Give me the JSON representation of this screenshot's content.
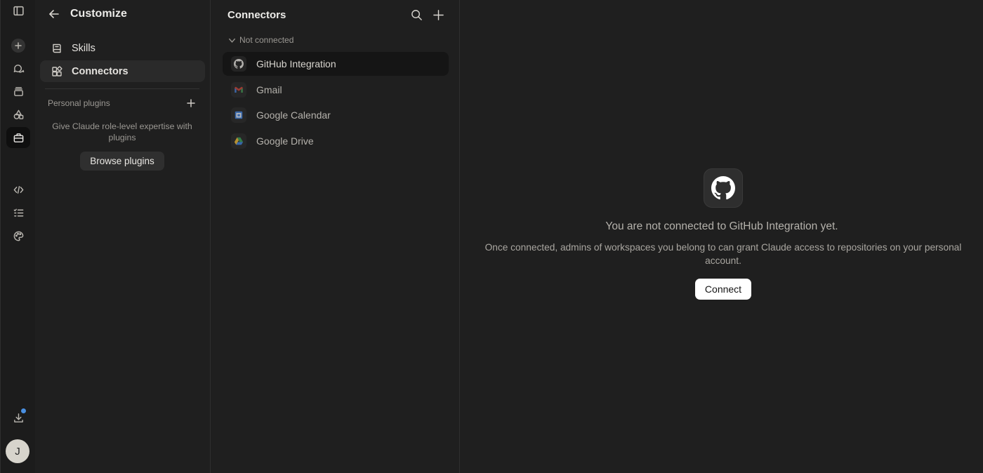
{
  "rail": {
    "items": [
      {
        "icon": "sidebar-toggle-icon"
      },
      {
        "icon": "plus-icon"
      },
      {
        "icon": "chats-icon"
      },
      {
        "icon": "projects-icon"
      },
      {
        "icon": "artifacts-icon"
      },
      {
        "icon": "briefcase-icon"
      },
      {
        "icon": "code-icon"
      },
      {
        "icon": "tasks-icon"
      },
      {
        "icon": "palette-icon"
      },
      {
        "icon": "download-icon"
      }
    ],
    "avatar_initial": "J",
    "notification_color": "#4a90e2"
  },
  "customize": {
    "title": "Customize",
    "nav": [
      {
        "label": "Skills",
        "icon": "skills-icon"
      },
      {
        "label": "Connectors",
        "icon": "connectors-icon",
        "active": true
      }
    ],
    "plugins_header": "Personal plugins",
    "plugins_text": "Give Claude role-level expertise with plugins",
    "browse_label": "Browse plugins"
  },
  "connectors": {
    "title": "Connectors",
    "section_label": "Not connected",
    "items": [
      {
        "label": "GitHub Integration",
        "icon": "github-icon",
        "active": true
      },
      {
        "label": "Gmail",
        "icon": "gmail-icon"
      },
      {
        "label": "Google Calendar",
        "icon": "google-calendar-icon"
      },
      {
        "label": "Google Drive",
        "icon": "google-drive-icon"
      }
    ]
  },
  "detail": {
    "title": "You are not connected to GitHub Integration yet.",
    "description": "Once connected, admins of workspaces you belong to can grant Claude access to repositories on your personal account.",
    "connect_label": "Connect"
  },
  "colors": {
    "background": "#1f1f1f",
    "rail": "#1c1c1c",
    "active_item": "#2a2a2a",
    "primary_button": "#ffffff"
  }
}
